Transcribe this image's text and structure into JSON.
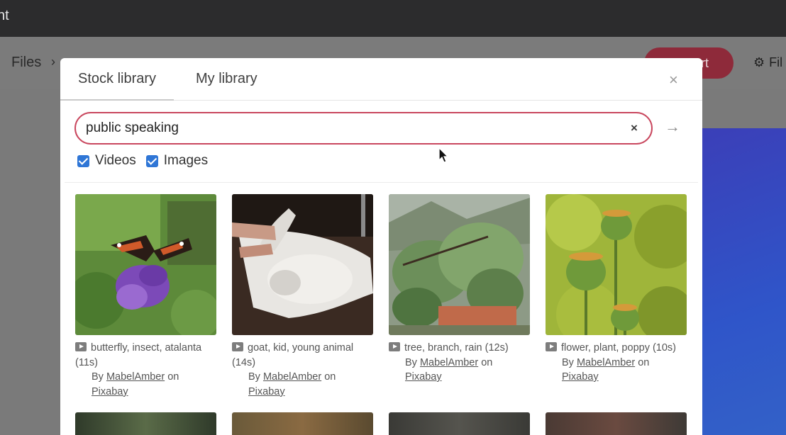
{
  "window": {
    "title": "nt"
  },
  "app_toolbar": {
    "breadcrumb_root": "Files",
    "breadcrumb_sep": "›",
    "export_label": "ort",
    "files_label": "Fil"
  },
  "modal": {
    "tabs": [
      {
        "label": "Stock library",
        "active": true
      },
      {
        "label": "My library",
        "active": false
      }
    ],
    "close_label": "×",
    "search": {
      "value": "public speaking",
      "placeholder": "",
      "clear_label": "×",
      "go_label": "→"
    },
    "filters": [
      {
        "label": "Videos",
        "checked": true
      },
      {
        "label": "Images",
        "checked": true
      }
    ],
    "results": [
      {
        "caption": "butterfly, insect, atalanta (11s)",
        "by_prefix": "By",
        "author": "MabelAmber",
        "on": "on",
        "source": "Pixabay",
        "media": "video"
      },
      {
        "caption": "goat, kid, young animal (14s)",
        "by_prefix": "By",
        "author": "MabelAmber",
        "on": "on",
        "source": "Pixabay",
        "media": "video"
      },
      {
        "caption": "tree, branch, rain (12s)",
        "by_prefix": "By",
        "author": "MabelAmber",
        "on": "on",
        "source": "Pixabay",
        "media": "video"
      },
      {
        "caption": "flower, plant, poppy (10s)",
        "by_prefix": "By",
        "author": "MabelAmber",
        "on": "on",
        "source": "Pixabay",
        "media": "video"
      }
    ]
  },
  "colors": {
    "accent": "#c9475e",
    "checkbox": "#2f76d6",
    "export_button_dimmed": "#8e2a3a"
  }
}
